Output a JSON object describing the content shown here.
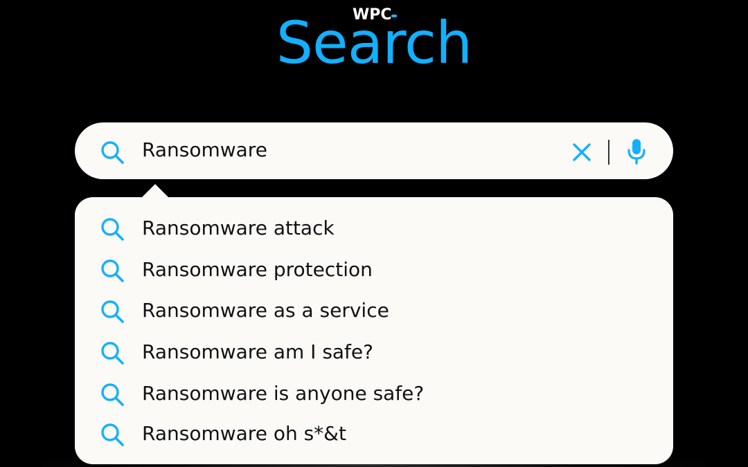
{
  "logo": {
    "brand": "WPC",
    "title": "Search"
  },
  "search": {
    "query": "Ransomware",
    "icons": {
      "search": "search-icon",
      "clear": "close-icon",
      "voice": "microphone-icon"
    }
  },
  "suggestions": [
    {
      "label": "Ransomware attack"
    },
    {
      "label": "Ransomware protection"
    },
    {
      "label": "Ransomware as a service"
    },
    {
      "label": "Ransomware am I safe?"
    },
    {
      "label": "Ransomware is anyone safe?"
    },
    {
      "label": "Ransomware oh s*&t"
    }
  ],
  "colors": {
    "accent": "#12b0ff",
    "background": "#000000",
    "panel": "#fbfaf7",
    "text": "#111111"
  }
}
